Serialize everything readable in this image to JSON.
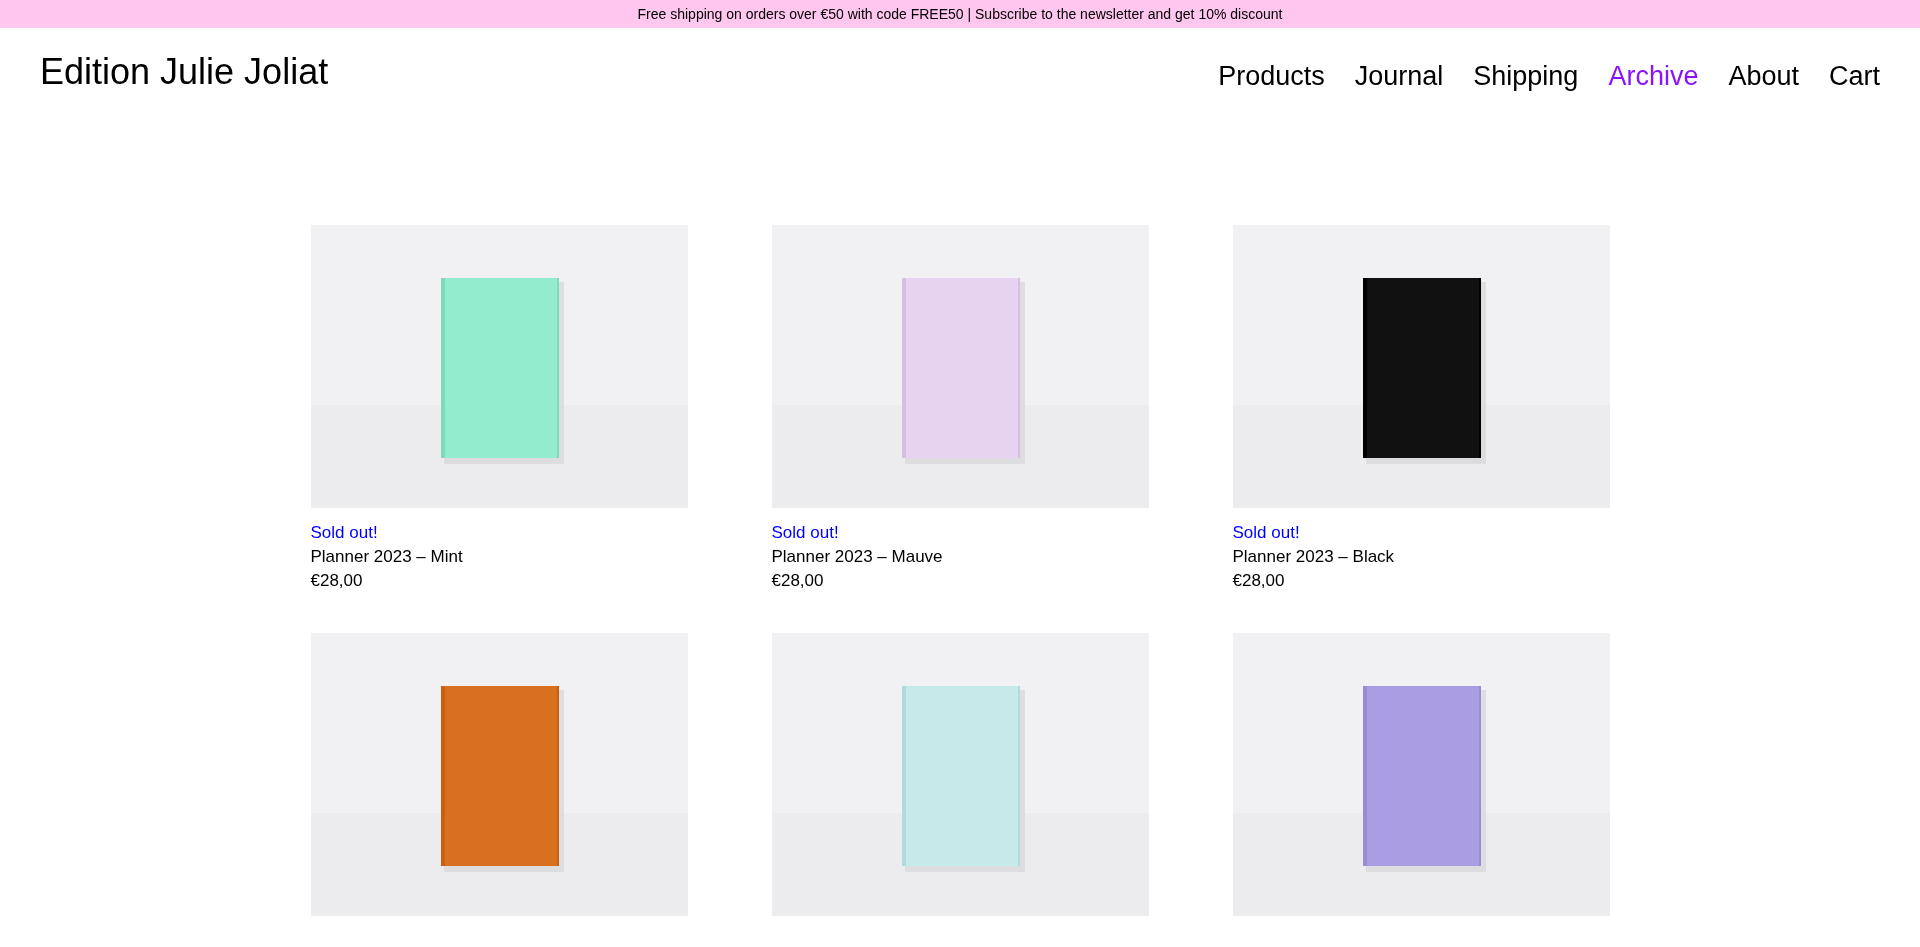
{
  "banner": {
    "text": "Free shipping on orders over €50 with code FREE50 | Subscribe to the newsletter and get 10% discount"
  },
  "header": {
    "logo": "Edition Julie Joliat",
    "nav": [
      {
        "label": "Products",
        "selected": false
      },
      {
        "label": "Journal",
        "selected": false
      },
      {
        "label": "Shipping",
        "selected": false
      },
      {
        "label": "Archive",
        "selected": true
      },
      {
        "label": "About",
        "selected": false
      },
      {
        "label": "Cart",
        "selected": false
      }
    ]
  },
  "products": [
    {
      "image": {
        "kind": "picture"
      },
      "status": "Sold out!",
      "title": "Planner 2023 – Mint",
      "price": "€28,00"
    },
    {
      "image": {
        "kind": "picture"
      },
      "status": "Sold out!",
      "title": "Planner 2023 – Mauve",
      "price": "€28,00"
    },
    {
      "image": {
        "kind": "picture"
      },
      "status": "Sold out!",
      "title": "Planner 2023 – Black",
      "price": "€28,00"
    },
    {
      "image": {
        "kind": "picture"
      }
    },
    {
      "image": {
        "kind": "picture"
      }
    },
    {
      "image": {
        "kind": "picture"
      }
    }
  ]
}
